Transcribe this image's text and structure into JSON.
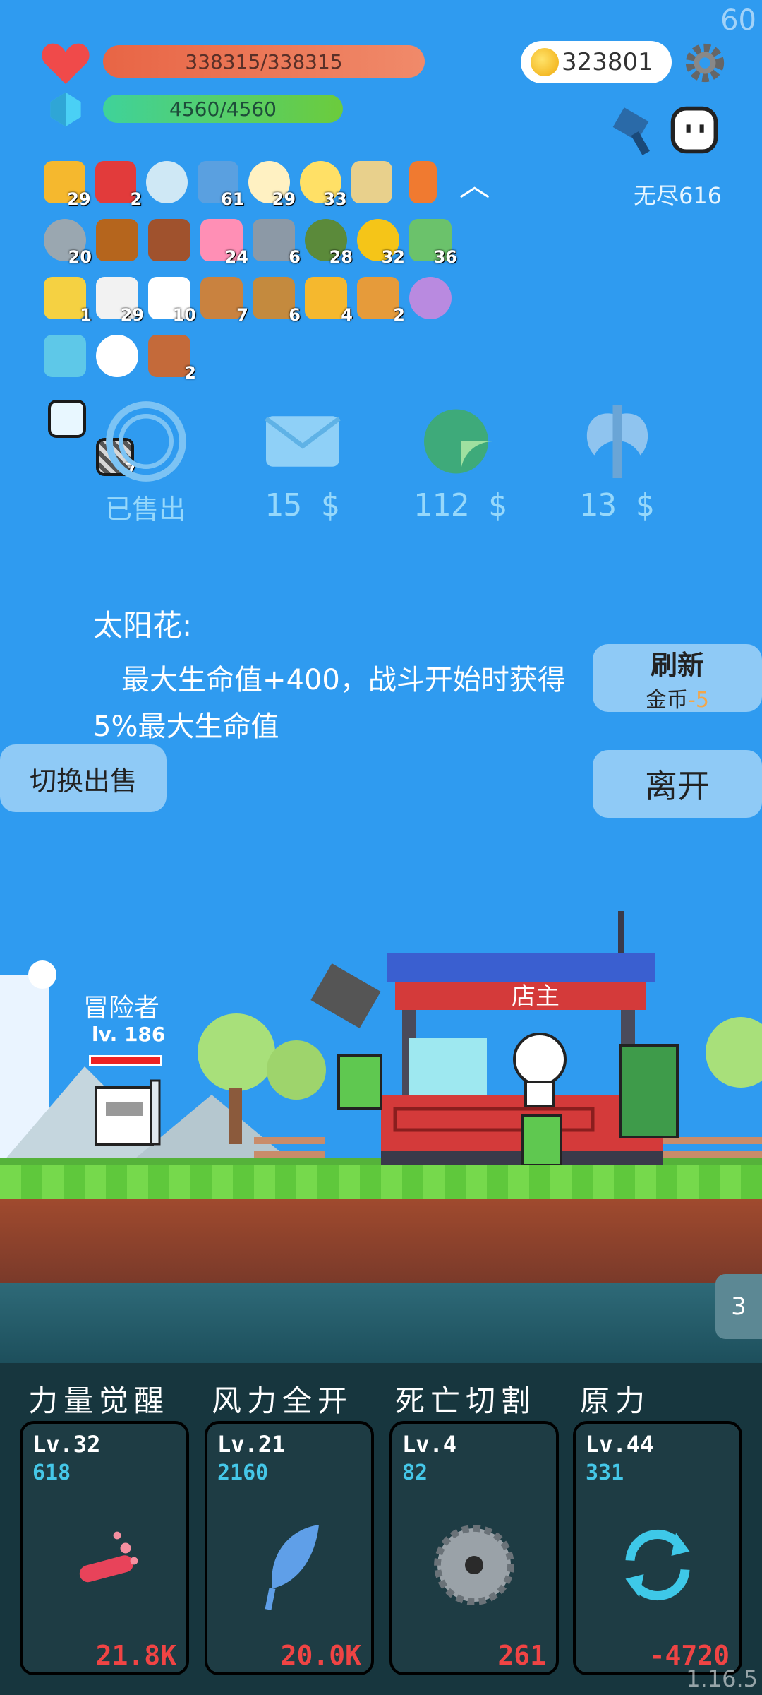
{
  "fps": "60",
  "hud": {
    "hp": "338315/338315",
    "mp": "4560/4560",
    "coins": "323801",
    "endless": "无尽616"
  },
  "inventory": {
    "rows": [
      [
        {
          "icon": "crown-icon",
          "count": "29",
          "color": "#f5b82e"
        },
        {
          "icon": "magnet-icon",
          "count": "2",
          "color": "#e23b3b"
        },
        {
          "icon": "magnifier-icon",
          "count": "",
          "color": "#cfe8f5"
        },
        {
          "icon": "star-card-icon",
          "count": "61",
          "color": "#5aa0e0"
        },
        {
          "icon": "egg-icon",
          "count": "29",
          "color": "#fff1c2"
        },
        {
          "icon": "lightbulb-icon",
          "count": "33",
          "color": "#ffe066"
        },
        {
          "icon": "treasure-map-icon",
          "count": "",
          "color": "#e8d08c"
        },
        {
          "icon": "torch-icon",
          "count": "",
          "color": "#f07a30"
        }
      ],
      [
        {
          "icon": "compass-icon",
          "count": "20",
          "color": "#9aa7b0"
        },
        {
          "icon": "chest-icon",
          "count": "",
          "color": "#b5651d"
        },
        {
          "icon": "chest-open-icon",
          "count": "",
          "color": "#a0522d"
        },
        {
          "icon": "ice-cream-icon",
          "count": "24",
          "color": "#ff8fb5"
        },
        {
          "icon": "axe-icon",
          "count": "6",
          "color": "#8c99a6"
        },
        {
          "icon": "grenade-icon",
          "count": "28",
          "color": "#5b8a3a"
        },
        {
          "icon": "sunflower-icon",
          "count": "32",
          "color": "#f5c518"
        },
        {
          "icon": "cash-heart-icon",
          "count": "36",
          "color": "#6bc26b"
        }
      ],
      [
        {
          "icon": "magic-wand-icon",
          "count": "1",
          "color": "#f5d142"
        },
        {
          "icon": "cards-icon",
          "count": "29",
          "color": "#f2f2f2"
        },
        {
          "icon": "dice-icon",
          "count": "10",
          "color": "#ffffff"
        },
        {
          "icon": "meteor-icon",
          "count": "7",
          "color": "#c9823f"
        },
        {
          "icon": "bow-icon",
          "count": "6",
          "color": "#c48a3e"
        },
        {
          "icon": "coin-stack-icon",
          "count": "4",
          "color": "#f5b82e"
        },
        {
          "icon": "book-icon",
          "count": "2",
          "color": "#e69b3a"
        },
        {
          "icon": "shield-icon",
          "count": "",
          "color": "#b98ae0"
        }
      ],
      [
        {
          "icon": "scroll-icon",
          "count": "",
          "color": "#5ec8e8"
        },
        {
          "icon": "cloud-icon",
          "count": "",
          "color": "#ffffff"
        },
        {
          "icon": "flag-icon",
          "count": "2",
          "color": "#c46a3a"
        }
      ]
    ],
    "extra": [
      {
        "icon": "bulb-tile-icon",
        "count": "",
        "color": "#e8f7ff"
      },
      {
        "icon": "striped-tile-icon",
        "count": "7",
        "color": "#d7d7d7"
      }
    ]
  },
  "shop": {
    "items": [
      {
        "icon": "sold-circle-icon",
        "label": "已售出"
      },
      {
        "icon": "envelope-icon",
        "label": "15 $"
      },
      {
        "icon": "lime-icon",
        "label": "112 $"
      },
      {
        "icon": "battle-axe-icon",
        "label": "13 $"
      }
    ],
    "desc_title": "太阳花:",
    "desc_text": "最大生命值+400，战斗开始时获得5%最大生命值",
    "refresh_label": "刷新",
    "refresh_cost_label": "金币",
    "refresh_cost": "-5",
    "switch_label": "切换出售",
    "leave_label": "离开"
  },
  "scene": {
    "hero_name": "冒险者",
    "hero_level": "lv. 186",
    "shop_sign": "店主",
    "page": "3"
  },
  "skills": [
    {
      "name": "力量觉醒",
      "level": "Lv.32",
      "value": "618",
      "bottom": "21.8K",
      "icon": "potion-icon"
    },
    {
      "name": "风力全开",
      "level": "Lv.21",
      "value": "2160",
      "bottom": "20.0K",
      "icon": "feather-icon"
    },
    {
      "name": "死亡切割",
      "level": "Lv.4",
      "value": "82",
      "bottom": "261",
      "icon": "saw-blade-icon"
    },
    {
      "name": "原力",
      "level": "Lv.44",
      "value": "331",
      "bottom": "-4720",
      "icon": "cycle-icon"
    }
  ],
  "version": "1.16.5"
}
